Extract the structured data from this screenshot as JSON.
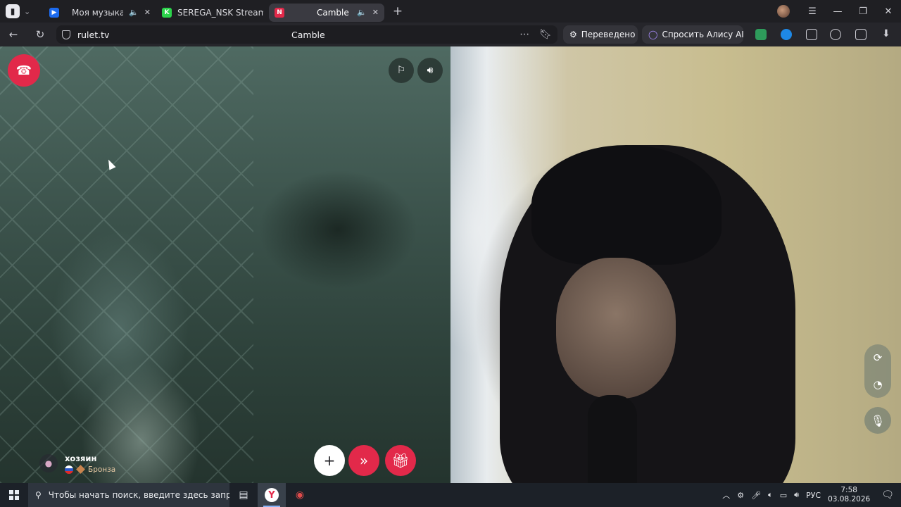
{
  "browser": {
    "tabs": [
      {
        "label": "Моя музыка",
        "favicon_color": "#1c6bf0",
        "has_audio": true
      },
      {
        "label": "SEREGA_NSK Stream - Wa",
        "favicon_color": "#2bd44b",
        "has_audio": false
      },
      {
        "label": "Camble",
        "favicon_color": "#e2294a",
        "has_audio": true,
        "active": true
      }
    ],
    "new_tab_symbol": "+",
    "address": "rulet.tv",
    "page_title": "Camble",
    "translated_label": "Переведено",
    "ask_alice_label": "Спросить Алису AI"
  },
  "call": {
    "partner_name": "хозяин",
    "partner_rank": "Бронза",
    "partner_country": "RU"
  },
  "colors": {
    "accent": "#e2294a",
    "hangup": "#e2294a",
    "dark_chrome": "#1f1f23"
  },
  "icons": {
    "hangup": "phone-hangup-icon",
    "report": "flag-icon",
    "volume": "speaker-icon",
    "add": "plus-icon",
    "next": "double-chevron-icon",
    "gift": "gift-icon",
    "switch_camera": "refresh-icon",
    "mic": "microphone-icon"
  },
  "taskbar": {
    "search_placeholder": "Чтобы начать поиск, введите здесь запрос",
    "language": "РУС",
    "time": "7:58",
    "date": "03.08.2026"
  }
}
